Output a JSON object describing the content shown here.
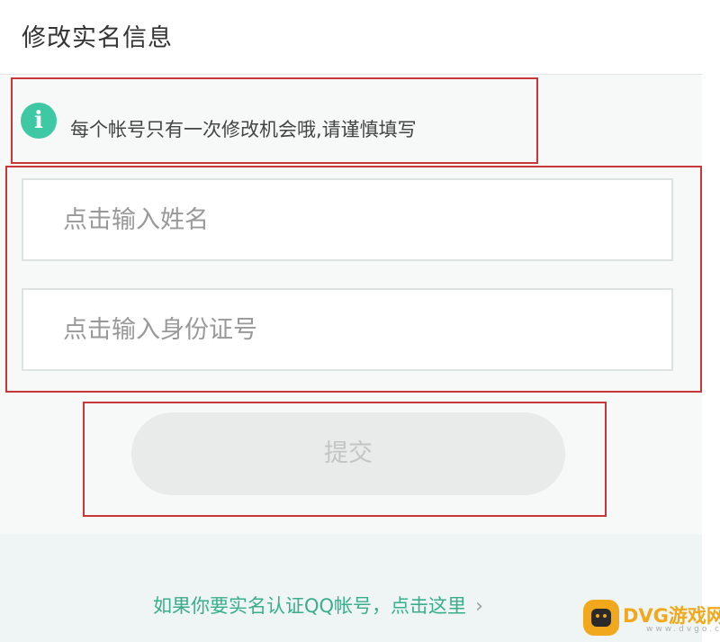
{
  "header": {
    "title": "修改实名信息"
  },
  "notice": {
    "icon": "info-icon",
    "icon_glyph": "i",
    "text": "每个帐号只有一次修改机会哦,请谨慎填写"
  },
  "form": {
    "name_field": {
      "value": "",
      "placeholder": "点击输入姓名"
    },
    "id_field": {
      "value": "",
      "placeholder": "点击输入身份证号"
    }
  },
  "submit": {
    "label": "提交"
  },
  "footer": {
    "link_text": "如果你要实名认证QQ帐号，点击这里",
    "chevron": "›"
  },
  "watermark": {
    "logo_text": "DVG游戏网",
    "sub_text": "www.dvgo.cc"
  },
  "colors": {
    "accent": "#3ec9a4",
    "link": "#3aae8a",
    "highlight_border": "#c8383b",
    "disabled_button": "#e9eaea",
    "watermark": "#f2a81c"
  }
}
